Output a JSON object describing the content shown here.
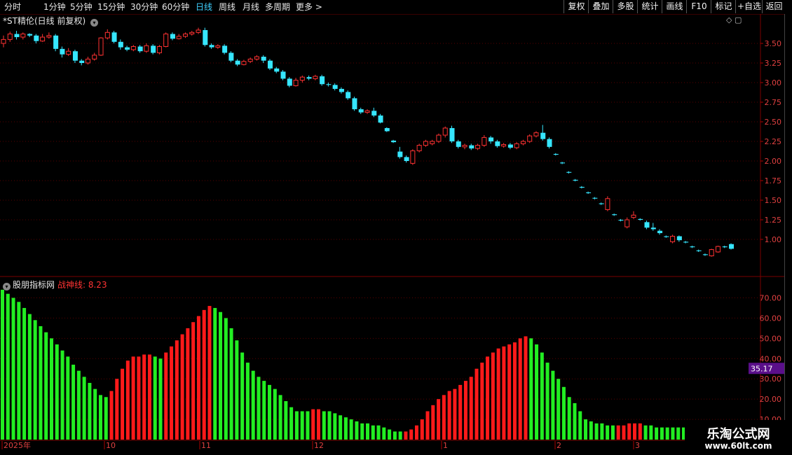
{
  "toolbar": {
    "timeframes": [
      "分时",
      "1分钟",
      "5分钟",
      "15分钟",
      "30分钟",
      "60分钟",
      "日线",
      "周线",
      "月线",
      "多周期",
      "更多 >"
    ],
    "active": "日线",
    "buttons": [
      "复权",
      "叠加",
      "多股",
      "统计",
      "画线",
      "F10",
      "标记",
      "+自选",
      "返回"
    ]
  },
  "main_chart": {
    "title": "*ST精伦(日线 前复权)",
    "price_ticks": [
      "3.50",
      "3.25",
      "3.00",
      "2.75",
      "2.50",
      "2.25",
      "2.00",
      "1.75",
      "1.50",
      "1.25",
      "1.00"
    ]
  },
  "indicator": {
    "name": "股朋指标网",
    "line_label": "战神线: 8.23",
    "ticks": [
      "70.00",
      "60.00",
      "50.00",
      "40.00",
      "30.00",
      "20.00",
      "10.00"
    ],
    "current_value": "35.17"
  },
  "date_axis": [
    "2025年",
    "10",
    "11",
    "12",
    "1",
    "2",
    "3"
  ],
  "watermark": {
    "line1": "乐淘公式网",
    "line2": "www.60lt.com"
  },
  "colors": {
    "up": "#ff3232",
    "down": "#36e6ff",
    "bar_up": "#ff1a1a",
    "bar_down": "#22ee22",
    "badge": "#5a0f8a"
  },
  "chart_data": [
    {
      "type": "candlestick",
      "title": "*ST精伦(日线 前复权)",
      "ylim": [
        0.8,
        3.75
      ],
      "candles": [
        [
          3.5,
          3.55,
          3.6,
          3.45
        ],
        [
          3.55,
          3.62,
          3.65,
          3.52
        ],
        [
          3.62,
          3.58,
          3.66,
          3.55
        ],
        [
          3.58,
          3.62,
          3.64,
          3.55
        ],
        [
          3.62,
          3.6,
          3.63,
          3.58
        ],
        [
          3.6,
          3.53,
          3.62,
          3.5
        ],
        [
          3.53,
          3.58,
          3.62,
          3.52
        ],
        [
          3.58,
          3.6,
          3.64,
          3.56
        ],
        [
          3.6,
          3.43,
          3.62,
          3.4
        ],
        [
          3.43,
          3.36,
          3.46,
          3.32
        ],
        [
          3.36,
          3.4,
          3.44,
          3.34
        ],
        [
          3.4,
          3.28,
          3.42,
          3.25
        ],
        [
          3.28,
          3.25,
          3.3,
          3.22
        ],
        [
          3.25,
          3.3,
          3.33,
          3.23
        ],
        [
          3.3,
          3.35,
          3.38,
          3.28
        ],
        [
          3.35,
          3.57,
          3.58,
          3.34
        ],
        [
          3.57,
          3.64,
          3.68,
          3.55
        ],
        [
          3.64,
          3.52,
          3.66,
          3.5
        ],
        [
          3.52,
          3.45,
          3.55,
          3.42
        ],
        [
          3.45,
          3.42,
          3.47,
          3.4
        ],
        [
          3.42,
          3.46,
          3.48,
          3.4
        ],
        [
          3.46,
          3.4,
          3.48,
          3.38
        ],
        [
          3.4,
          3.47,
          3.5,
          3.38
        ],
        [
          3.47,
          3.38,
          3.49,
          3.36
        ],
        [
          3.38,
          3.46,
          3.48,
          3.36
        ],
        [
          3.46,
          3.62,
          3.64,
          3.45
        ],
        [
          3.62,
          3.56,
          3.64,
          3.54
        ],
        [
          3.56,
          3.59,
          3.62,
          3.55
        ],
        [
          3.59,
          3.62,
          3.64,
          3.57
        ],
        [
          3.62,
          3.64,
          3.66,
          3.6
        ],
        [
          3.64,
          3.67,
          3.7,
          3.62
        ],
        [
          3.67,
          3.48,
          3.7,
          3.46
        ],
        [
          3.48,
          3.45,
          3.5,
          3.43
        ],
        [
          3.45,
          3.47,
          3.49,
          3.43
        ],
        [
          3.47,
          3.38,
          3.49,
          3.36
        ],
        [
          3.38,
          3.28,
          3.4,
          3.26
        ],
        [
          3.28,
          3.23,
          3.3,
          3.21
        ],
        [
          3.23,
          3.27,
          3.29,
          3.22
        ],
        [
          3.27,
          3.3,
          3.32,
          3.25
        ],
        [
          3.3,
          3.33,
          3.35,
          3.28
        ],
        [
          3.33,
          3.28,
          3.35,
          3.25
        ],
        [
          3.28,
          3.18,
          3.3,
          3.16
        ],
        [
          3.18,
          3.14,
          3.2,
          3.12
        ],
        [
          3.14,
          3.05,
          3.16,
          3.03
        ],
        [
          3.05,
          2.96,
          3.07,
          2.94
        ],
        [
          2.96,
          3.03,
          3.06,
          2.95
        ],
        [
          3.03,
          3.07,
          3.09,
          3.0
        ],
        [
          3.07,
          3.05,
          3.09,
          3.03
        ],
        [
          3.05,
          3.08,
          3.1,
          3.03
        ],
        [
          3.08,
          2.98,
          3.1,
          2.96
        ],
        [
          2.98,
          2.97,
          3.0,
          2.95
        ],
        [
          2.97,
          2.92,
          2.99,
          2.9
        ],
        [
          2.92,
          2.88,
          2.94,
          2.86
        ],
        [
          2.88,
          2.8,
          2.9,
          2.78
        ],
        [
          2.8,
          2.66,
          2.82,
          2.64
        ],
        [
          2.66,
          2.62,
          2.68,
          2.6
        ],
        [
          2.62,
          2.64,
          2.66,
          2.6
        ],
        [
          2.64,
          2.58,
          2.68,
          2.56
        ],
        [
          2.58,
          2.49,
          2.6,
          2.48
        ],
        [
          2.42,
          2.38,
          2.43,
          2.37
        ],
        [
          2.26,
          2.24,
          2.27,
          2.23
        ],
        [
          2.12,
          2.05,
          2.18,
          2.03
        ],
        [
          2.05,
          2.0,
          2.07,
          1.98
        ],
        [
          1.97,
          2.13,
          2.15,
          1.95
        ],
        [
          2.13,
          2.2,
          2.22,
          2.11
        ],
        [
          2.2,
          2.25,
          2.27,
          2.18
        ],
        [
          2.22,
          2.25,
          2.27,
          2.2
        ],
        [
          2.25,
          2.33,
          2.35,
          2.23
        ],
        [
          2.33,
          2.42,
          2.44,
          2.3
        ],
        [
          2.42,
          2.25,
          2.45,
          2.23
        ],
        [
          2.25,
          2.18,
          2.27,
          2.16
        ],
        [
          2.18,
          2.2,
          2.22,
          2.15
        ],
        [
          2.2,
          2.16,
          2.22,
          2.14
        ],
        [
          2.16,
          2.2,
          2.22,
          2.14
        ],
        [
          2.2,
          2.3,
          2.33,
          2.18
        ],
        [
          2.3,
          2.25,
          2.32,
          2.22
        ],
        [
          2.25,
          2.19,
          2.27,
          2.17
        ],
        [
          2.19,
          2.21,
          2.23,
          2.17
        ],
        [
          2.21,
          2.17,
          2.23,
          2.15
        ],
        [
          2.17,
          2.22,
          2.24,
          2.15
        ],
        [
          2.22,
          2.25,
          2.27,
          2.2
        ],
        [
          2.25,
          2.32,
          2.34,
          2.23
        ],
        [
          2.32,
          2.36,
          2.38,
          2.3
        ],
        [
          2.36,
          2.28,
          2.46,
          2.26
        ],
        [
          2.28,
          2.18,
          2.3,
          2.16
        ],
        [
          2.09,
          2.08,
          2.1,
          2.07
        ],
        [
          1.98,
          1.97,
          1.99,
          1.96
        ],
        [
          1.86,
          1.85,
          1.87,
          1.84
        ],
        [
          1.76,
          1.75,
          1.77,
          1.74
        ],
        [
          1.67,
          1.66,
          1.68,
          1.65
        ],
        [
          1.6,
          1.59,
          1.61,
          1.58
        ],
        [
          1.53,
          1.52,
          1.54,
          1.51
        ],
        [
          1.46,
          1.45,
          1.47,
          1.44
        ],
        [
          1.38,
          1.52,
          1.55,
          1.36
        ],
        [
          1.32,
          1.31,
          1.33,
          1.3
        ],
        [
          1.25,
          1.24,
          1.26,
          1.23
        ],
        [
          1.16,
          1.25,
          1.28,
          1.14
        ],
        [
          1.28,
          1.31,
          1.36,
          1.26
        ],
        [
          1.26,
          1.25,
          1.27,
          1.24
        ],
        [
          1.22,
          1.15,
          1.24,
          1.13
        ],
        [
          1.15,
          1.13,
          1.21,
          1.11
        ],
        [
          1.11,
          1.08,
          1.13,
          1.06
        ],
        [
          1.04,
          1.03,
          1.05,
          1.02
        ],
        [
          0.97,
          1.04,
          1.06,
          0.95
        ],
        [
          1.04,
          0.99,
          1.05,
          0.97
        ],
        [
          0.97,
          0.96,
          0.98,
          0.95
        ],
        [
          0.91,
          0.9,
          0.92,
          0.89
        ],
        [
          0.86,
          0.85,
          0.87,
          0.84
        ],
        [
          0.81,
          0.8,
          0.82,
          0.79
        ],
        [
          0.79,
          0.87,
          0.88,
          0.78
        ],
        [
          0.84,
          0.91,
          0.92,
          0.83
        ],
        [
          0.91,
          0.9,
          0.92,
          0.89
        ],
        [
          0.94,
          0.88,
          0.95,
          0.87
        ]
      ]
    },
    {
      "type": "bar",
      "name": "股朋指标网",
      "ylim": [
        0,
        75
      ],
      "values": [
        74,
        72,
        70,
        68,
        65,
        62,
        59,
        56,
        53,
        50,
        47,
        44,
        41,
        37,
        34,
        31,
        28,
        25,
        22,
        21,
        24,
        30,
        35,
        39,
        41,
        41,
        42,
        42,
        41,
        40,
        43,
        46,
        49,
        52,
        55,
        58,
        61,
        64,
        66,
        65,
        63,
        60,
        55,
        49,
        43,
        38,
        34,
        31,
        29,
        27,
        25,
        22,
        19,
        16,
        14,
        14,
        14,
        15,
        15,
        14,
        14,
        13,
        12,
        11,
        10,
        9,
        8,
        8,
        7,
        7,
        6,
        5,
        4,
        4,
        4,
        5,
        7,
        10,
        14,
        17,
        20,
        22,
        24,
        25,
        27,
        29,
        31,
        35,
        38,
        41,
        43,
        45,
        46,
        47,
        48,
        50,
        51,
        50,
        47,
        43,
        38,
        34,
        30,
        26,
        21,
        18,
        14,
        10,
        9,
        8,
        8,
        7,
        7,
        7,
        7,
        8,
        8,
        8,
        7,
        7,
        6,
        6,
        6,
        6,
        6,
        6
      ],
      "up": [
        0,
        0,
        0,
        0,
        0,
        0,
        0,
        0,
        0,
        0,
        0,
        0,
        0,
        0,
        0,
        0,
        0,
        0,
        0,
        0,
        1,
        1,
        1,
        1,
        1,
        1,
        1,
        1,
        0,
        0,
        1,
        1,
        1,
        1,
        1,
        1,
        1,
        1,
        1,
        0,
        0,
        0,
        0,
        0,
        0,
        0,
        0,
        0,
        0,
        0,
        0,
        0,
        0,
        0,
        0,
        0,
        0,
        1,
        1,
        0,
        0,
        0,
        0,
        0,
        0,
        0,
        0,
        0,
        0,
        0,
        0,
        0,
        0,
        0,
        1,
        1,
        1,
        1,
        1,
        1,
        1,
        1,
        1,
        1,
        1,
        1,
        1,
        1,
        1,
        1,
        1,
        1,
        1,
        1,
        1,
        1,
        1,
        0,
        0,
        0,
        0,
        0,
        0,
        0,
        0,
        0,
        0,
        0,
        0,
        0,
        0,
        0,
        0,
        1,
        1,
        1,
        1,
        1,
        0,
        0,
        0,
        0,
        0,
        0,
        0,
        0
      ]
    }
  ]
}
